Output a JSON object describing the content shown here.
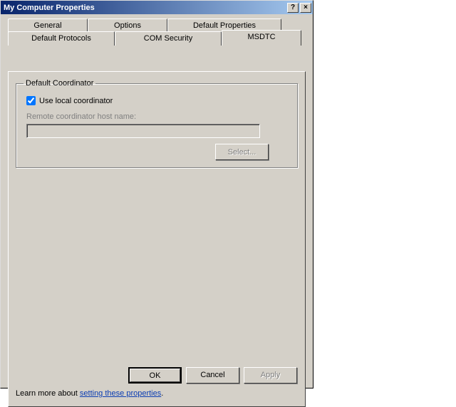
{
  "window": {
    "title": "My Computer Properties",
    "help_glyph": "?",
    "close_glyph": "×"
  },
  "tabs": {
    "row1": [
      {
        "label": "General",
        "width": 112
      },
      {
        "label": "Options",
        "width": 112
      },
      {
        "label": "Default Properties",
        "width": 160
      }
    ],
    "row2": [
      {
        "label": "Default Protocols",
        "width": 150
      },
      {
        "label": "COM Security",
        "width": 150
      },
      {
        "label": "MSDTC",
        "width": 112,
        "active": true
      }
    ]
  },
  "group": {
    "legend": "Default Coordinator",
    "use_local_label": "Use local coordinator",
    "use_local_checked": true,
    "remote_host_label": "Remote coordinator host name:",
    "remote_host_value": "",
    "select_button": "Select..."
  },
  "learn_more": {
    "prefix": "Learn more about ",
    "link": "setting these properties",
    "suffix": "."
  },
  "buttons": {
    "ok": "OK",
    "cancel": "Cancel",
    "apply": "Apply"
  }
}
